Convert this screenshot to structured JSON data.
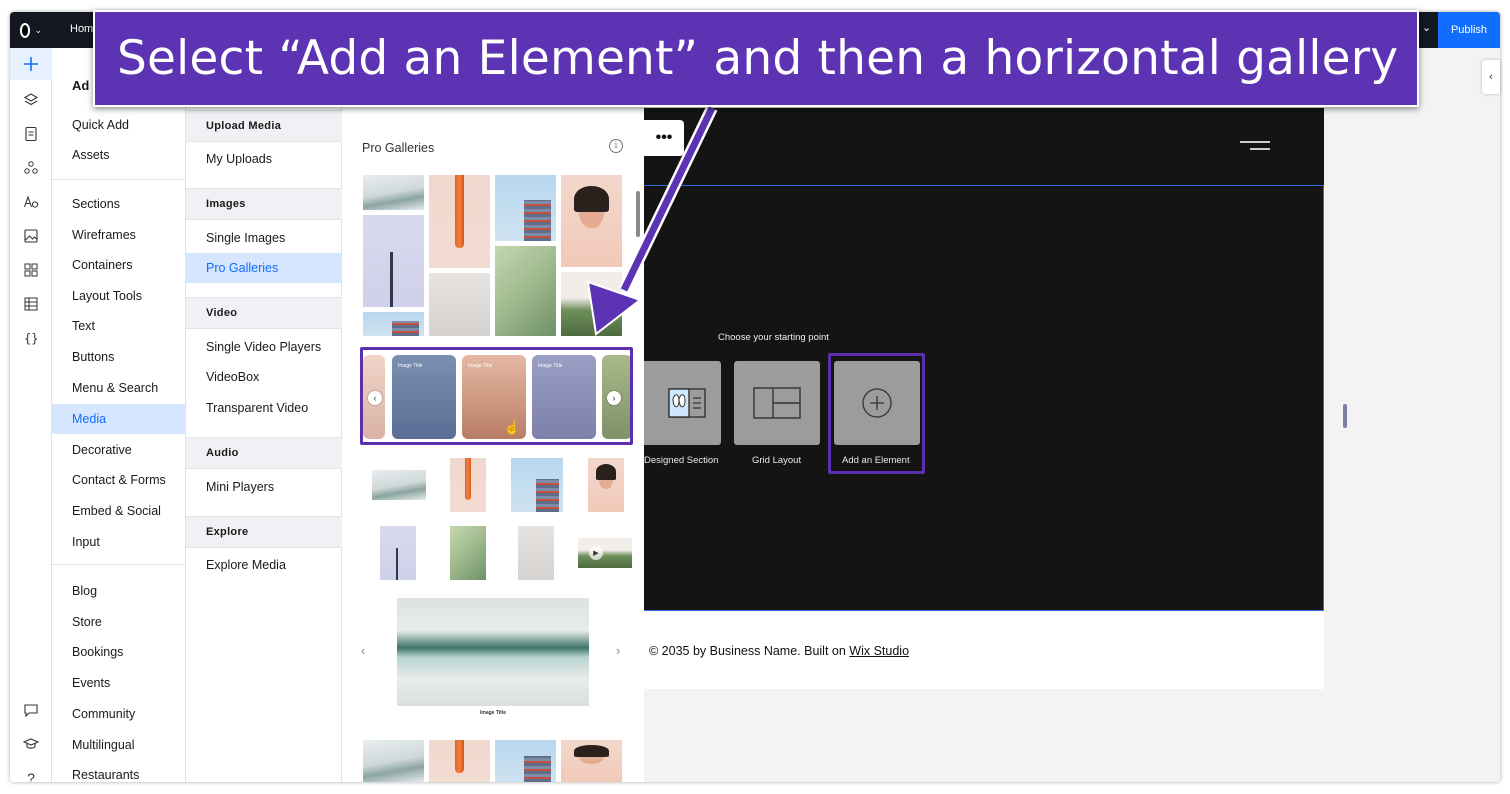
{
  "topbar": {
    "page_label": "Hom",
    "publish_label": "Publish"
  },
  "rail": {
    "icons": [
      "add-icon",
      "layers-icon",
      "pages-icon",
      "apps-icon",
      "theme-icon",
      "media-icon",
      "app-market-icon",
      "cms-icon",
      "code-icon",
      "chat-icon",
      "learn-icon",
      "help-icon"
    ],
    "help_label": "?"
  },
  "add_panel": {
    "title": "Ad",
    "categories": [
      "Quick Add",
      "Assets",
      "Sections",
      "Wireframes",
      "Containers",
      "Layout Tools",
      "Text",
      "Buttons",
      "Menu & Search",
      "Media",
      "Decorative",
      "Contact & Forms",
      "Embed & Social",
      "Input",
      "Blog",
      "Store",
      "Bookings",
      "Events",
      "Community",
      "Multilingual",
      "Restaurants"
    ],
    "active_category": "Media"
  },
  "media_panel": {
    "groups": [
      {
        "header": "Upload Media",
        "items": [
          "My Uploads"
        ]
      },
      {
        "header": "Images",
        "items": [
          "Single Images",
          "Pro Galleries"
        ]
      },
      {
        "header": "Video",
        "items": [
          "Single Video Players",
          "VideoBox",
          "Transparent Video"
        ]
      },
      {
        "header": "Audio",
        "items": [
          "Mini Players"
        ]
      },
      {
        "header": "Explore",
        "items": [
          "Explore Media"
        ]
      }
    ],
    "active_item": "Pro Galleries"
  },
  "gallery_panel": {
    "title": "Pro Galleries",
    "info_icon": "info-icon",
    "horizontal_gallery_tile_text": "Image Title",
    "slide_caption": "Image Title"
  },
  "canvas": {
    "header_dots": "•••",
    "choose_label": "Choose your starting point",
    "start_options": [
      "Designed Section",
      "Grid Layout",
      "Add an Element"
    ],
    "footer_text": "© 2035 by Business Name. Built on ",
    "footer_link": "Wix Studio"
  },
  "annotation": {
    "text": "Select “Add an Element” and then a horizontal gallery",
    "color": "#5b33b3"
  },
  "colors": {
    "accent": "#116dff",
    "highlight": "#5b2fad",
    "topbar": "#131720",
    "site_dark": "#141414"
  }
}
